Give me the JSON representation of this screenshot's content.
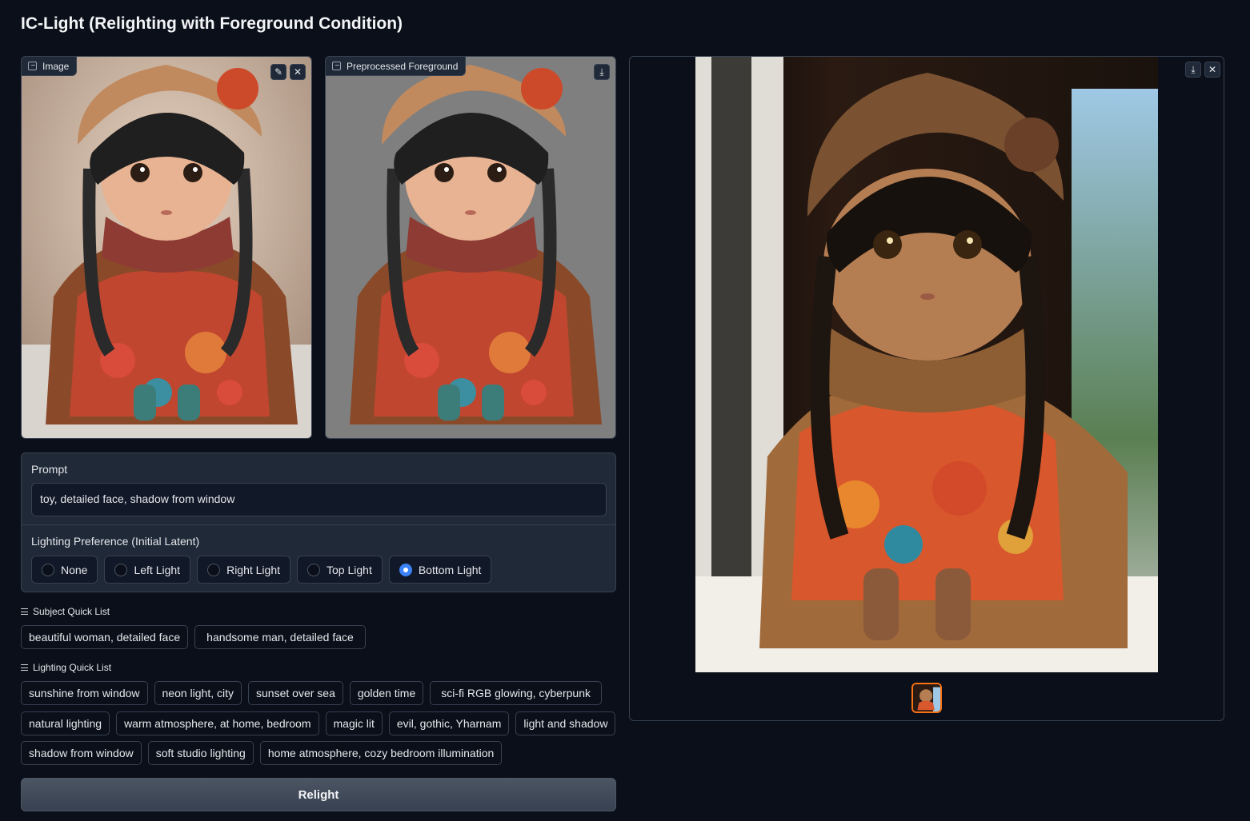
{
  "app": {
    "title": "IC-Light (Relighting with Foreground Condition)"
  },
  "input_image": {
    "label": "Image",
    "edit_icon": "pencil-icon",
    "clear_icon": "close-icon"
  },
  "preprocessed": {
    "label": "Preprocessed Foreground",
    "download_icon": "download-icon"
  },
  "prompt": {
    "label": "Prompt",
    "value": "toy, detailed face, shadow from window"
  },
  "lighting": {
    "label": "Lighting Preference (Initial Latent)",
    "options": [
      "None",
      "Left Light",
      "Right Light",
      "Top Light",
      "Bottom Light"
    ],
    "selected": "Bottom Light"
  },
  "subject_quick_list": {
    "label": "Subject Quick List",
    "items": [
      "beautiful woman, detailed face",
      "handsome man, detailed face"
    ]
  },
  "lighting_quick_list": {
    "label": "Lighting Quick List",
    "rows": [
      [
        "sunshine from window",
        "neon light, city",
        "sunset over sea",
        "golden time",
        "sci-fi RGB glowing, cyberpunk"
      ],
      [
        "natural lighting",
        "warm atmosphere, at home, bedroom",
        "magic lit",
        "evil, gothic, Yharnam",
        "light and shadow"
      ],
      [
        "shadow from window",
        "soft studio lighting",
        "home atmosphere, cozy bedroom illumination"
      ]
    ]
  },
  "relight_button": {
    "label": "Relight"
  },
  "output": {
    "download_icon": "download-icon",
    "clear_icon": "close-icon"
  },
  "colors": {
    "accent": "#3b82f6",
    "thumb_border": "#f97316",
    "background": "#0b0f19",
    "panel": "#1f2937"
  }
}
